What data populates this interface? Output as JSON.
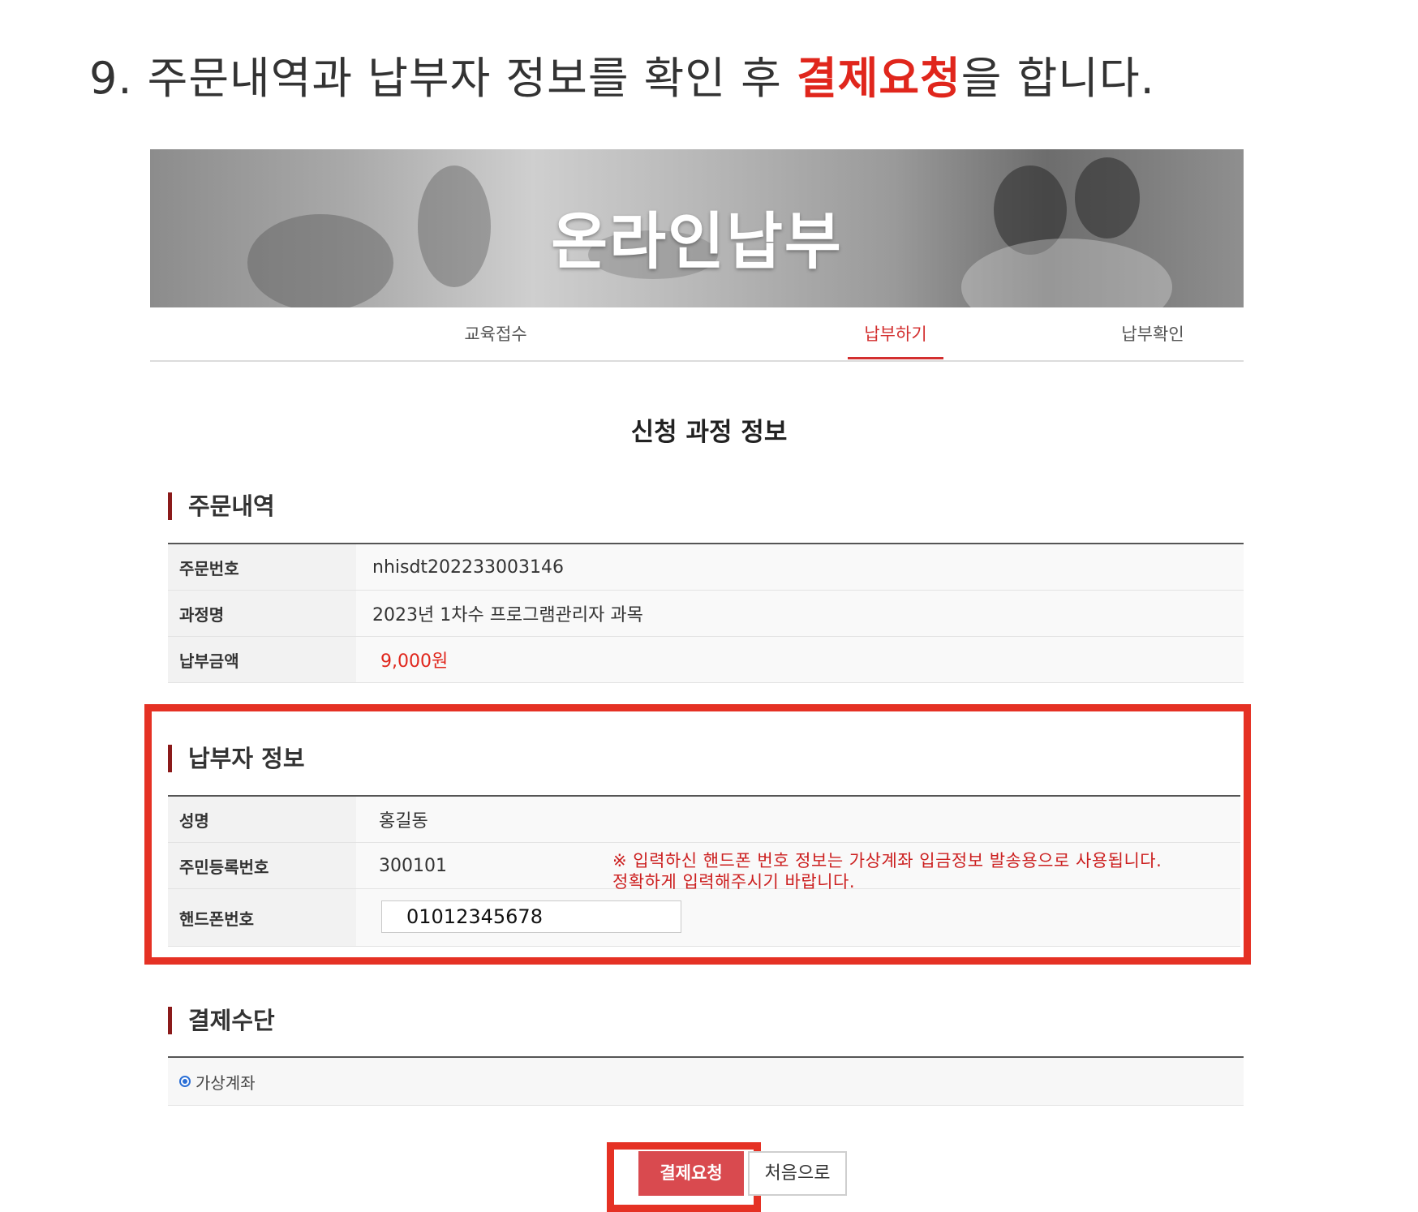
{
  "instruction": {
    "prefix": "9. 주문내역과 납부자 정보를 확인 후 ",
    "highlight": "결제요청",
    "suffix": "을 합니다."
  },
  "banner": {
    "title": "온라인납부"
  },
  "tabs": [
    {
      "label": "교육접수",
      "active": false
    },
    {
      "label": "납부하기",
      "active": true
    },
    {
      "label": "납부확인",
      "active": false
    }
  ],
  "section_title": "신청 과정 정보",
  "order": {
    "heading": "주문내역",
    "rows": [
      {
        "label": "주문번호",
        "value": "nhisdt202233003146"
      },
      {
        "label": "과정명",
        "value": "2023년 1차수 프로그램관리자 과목"
      },
      {
        "label": "납부금액",
        "value": "9,000원"
      }
    ]
  },
  "payer": {
    "heading": "납부자 정보",
    "rows": [
      {
        "label": "성명",
        "value": "홍길동"
      },
      {
        "label": "주민등록번호",
        "value": "300101"
      },
      {
        "label": "핸드폰번호",
        "value": "01012345678"
      }
    ],
    "notice_line1": "※ 입력하신 핸드폰 번호 정보는 가상계좌 입금정보 발송용으로 사용됩니다.",
    "notice_line2": "정확하게 입력해주시기 바랍니다."
  },
  "payment": {
    "heading": "결제수단",
    "option_label": "가상계좌"
  },
  "buttons": {
    "pay_label": "결제요청",
    "home_label": "처음으로"
  },
  "colors": {
    "accent_red": "#e0261c",
    "highlight_border": "#e53124",
    "heading_bar": "#8b1a1a",
    "pay_button": "#d94a4f",
    "radio_blue": "#2b6fd6"
  }
}
